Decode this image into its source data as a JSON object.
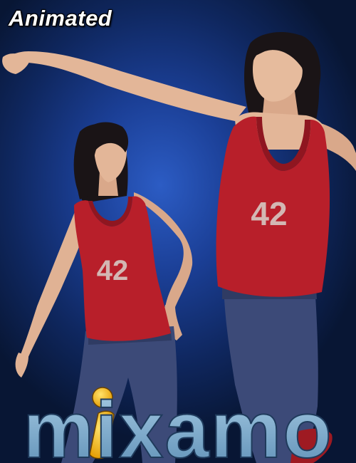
{
  "badge": {
    "label": "Animated"
  },
  "figures": {
    "left": {
      "shirt_number": "42"
    },
    "right": {
      "shirt_number": "42"
    }
  },
  "logo": {
    "wordmark": "mixamo"
  },
  "colors": {
    "background": "#1b3f96",
    "shirt": "#b81f2a",
    "jeans": "#3c4a78",
    "skin": "#e3b698",
    "hair": "#1a1416",
    "logo_text": "#6f9fc2",
    "logo_accent": "#f2b50c"
  }
}
